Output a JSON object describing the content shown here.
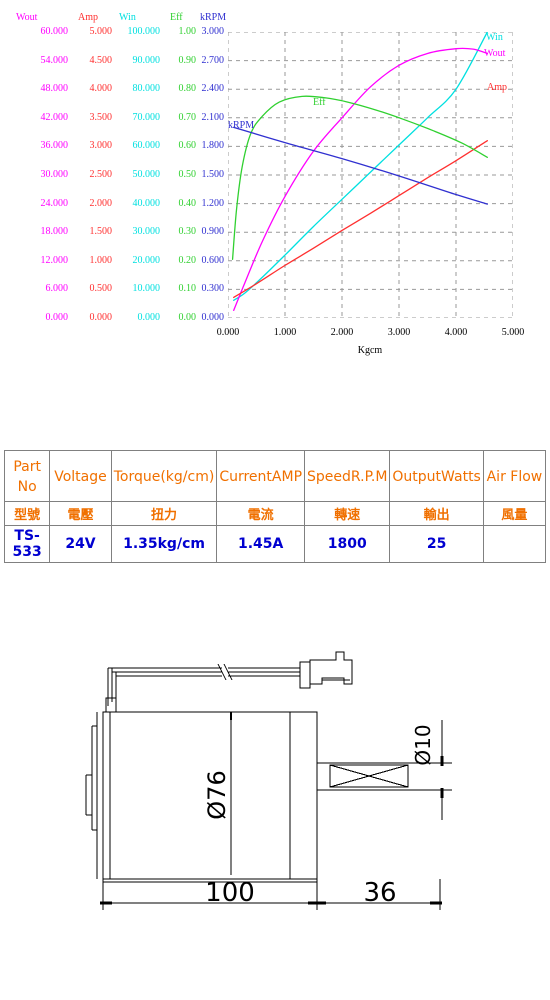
{
  "chart_data": {
    "type": "line",
    "title": "",
    "xlabel": "Kgcm",
    "xticks": [
      "0.000",
      "1.000",
      "2.000",
      "3.000",
      "4.000",
      "5.000"
    ],
    "xlim": [
      0,
      5
    ],
    "grid": true,
    "legend_position": "inline-right",
    "axes": [
      {
        "name": "Wout",
        "color": "#FF00FF",
        "ticks": [
          "60.000",
          "54.000",
          "48.000",
          "42.000",
          "36.000",
          "30.000",
          "24.000",
          "18.000",
          "12.000",
          "6.000",
          "0.000"
        ],
        "range": [
          0,
          60
        ]
      },
      {
        "name": "Amp",
        "color": "#FF3030",
        "ticks": [
          "5.000",
          "4.500",
          "4.000",
          "3.500",
          "3.000",
          "2.500",
          "2.000",
          "1.500",
          "1.000",
          "0.500",
          "0.000"
        ],
        "range": [
          0,
          5
        ]
      },
      {
        "name": "Win",
        "color": "#00E0E0",
        "ticks": [
          "100.000",
          "90.000",
          "80.000",
          "70.000",
          "60.000",
          "50.000",
          "40.000",
          "30.000",
          "20.000",
          "10.000",
          "0.000"
        ],
        "range": [
          0,
          100
        ]
      },
      {
        "name": "Eff",
        "color": "#30D030",
        "ticks": [
          "1.00",
          "0.90",
          "0.80",
          "0.70",
          "0.60",
          "0.50",
          "0.40",
          "0.30",
          "0.20",
          "0.10",
          "0.00"
        ],
        "range": [
          0,
          1
        ]
      },
      {
        "name": "kRPM",
        "color": "#3030D0",
        "ticks": [
          "3.000",
          "2.700",
          "2.400",
          "2.100",
          "1.800",
          "1.500",
          "1.200",
          "0.900",
          "0.600",
          "0.300",
          "0.000"
        ],
        "range": [
          0,
          3
        ]
      }
    ],
    "series": [
      {
        "name": "Win",
        "color": "#00E0E0",
        "label": "Win",
        "unit": "Watts",
        "x": [
          0.1,
          0.3,
          0.6,
          1.0,
          1.5,
          2.0,
          2.5,
          3.0,
          3.5,
          4.0,
          4.55
        ],
        "y": [
          6.2,
          8.8,
          14.2,
          22.0,
          32.0,
          41.5,
          51.0,
          60.5,
          70.0,
          80.0,
          100.0
        ]
      },
      {
        "name": "Wout",
        "color": "#FF00FF",
        "label": "Wout",
        "unit": "Watts",
        "x": [
          0.1,
          0.3,
          0.6,
          1.0,
          1.5,
          2.0,
          2.5,
          3.0,
          3.5,
          4.0,
          4.3,
          4.55
        ],
        "y": [
          1.6,
          7.5,
          16.0,
          25.5,
          35.0,
          42.0,
          48.5,
          53.0,
          55.5,
          56.5,
          56.4,
          55.5
        ]
      },
      {
        "name": "Amp",
        "color": "#FF3030",
        "label": "Amp",
        "unit": "A",
        "x": [
          0.1,
          0.5,
          1.0,
          1.5,
          2.0,
          2.5,
          3.0,
          3.5,
          4.0,
          4.55
        ],
        "y": [
          0.36,
          0.6,
          0.92,
          1.22,
          1.53,
          1.83,
          2.14,
          2.45,
          2.75,
          3.1
        ]
      },
      {
        "name": "Eff",
        "color": "#30D030",
        "label": "Eff",
        "unit": "",
        "x": [
          0.08,
          0.15,
          0.25,
          0.4,
          0.6,
          0.9,
          1.3,
          1.7,
          2.1,
          2.6,
          3.1,
          3.6,
          4.1,
          4.55
        ],
        "y": [
          0.205,
          0.38,
          0.53,
          0.645,
          0.705,
          0.755,
          0.775,
          0.77,
          0.755,
          0.727,
          0.693,
          0.655,
          0.612,
          0.562
        ]
      },
      {
        "name": "kRPM",
        "color": "#3030D0",
        "label": "kRPM",
        "unit": "kRPM",
        "x": [
          0.1,
          1.0,
          2.0,
          3.0,
          4.0,
          4.55
        ],
        "y": [
          2.0,
          1.84,
          1.672,
          1.49,
          1.295,
          1.195
        ]
      }
    ]
  },
  "spec_table": {
    "headers_en": [
      {
        "l1": "Part No",
        "l2": ""
      },
      {
        "l1": "Voltage",
        "l2": ""
      },
      {
        "l1": "Torque",
        "l2": "(kg/cm)"
      },
      {
        "l1": "Current",
        "l2": "AMP"
      },
      {
        "l1": "Speed",
        "l2": "R.P.M"
      },
      {
        "l1": "Output",
        "l2": "Watts"
      },
      {
        "l1": "Air  Flow",
        "l2": ""
      }
    ],
    "headers_cn": [
      "型號",
      "電壓",
      "扭力",
      "電流",
      "轉速",
      "輸出",
      "風量"
    ],
    "values": [
      "TS-533",
      "24V",
      "1.35kg/cm",
      "1.45A",
      "1800",
      "25",
      ""
    ]
  },
  "drawing": {
    "dim_body_length": "100",
    "dim_shaft_length": "36",
    "dim_diameter": "Ø76",
    "dim_shaft_diameter": "Ø10"
  }
}
